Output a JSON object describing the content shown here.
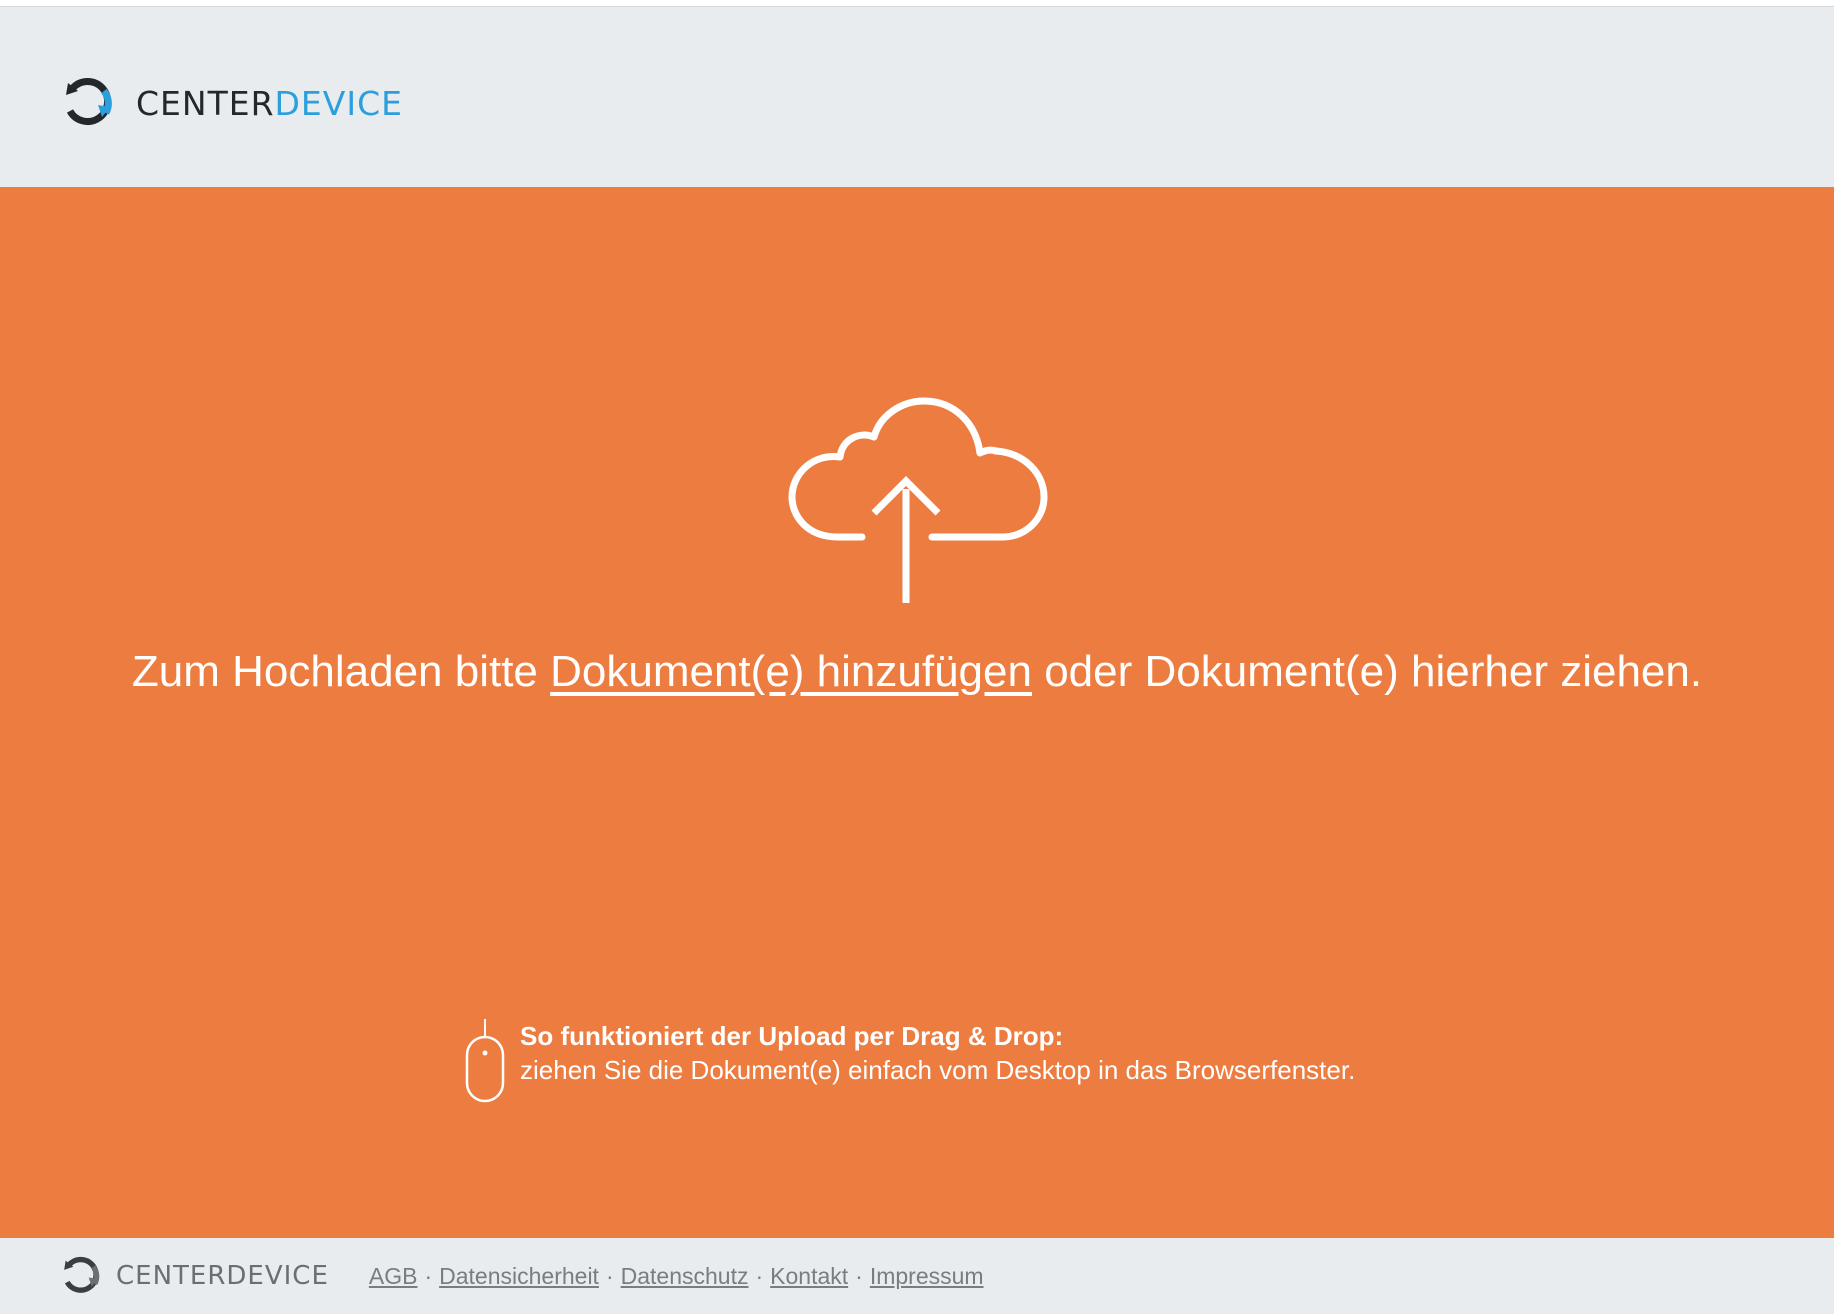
{
  "header": {
    "brand_dark": "CENTER",
    "brand_blue": "DEVICE"
  },
  "dropzone": {
    "text_before": "Zum Hochladen bitte ",
    "link_label": "Dokument(e) hinzufügen",
    "text_after": " oder Dokument(e) hierher ziehen.",
    "hint_title": "So funktioniert der Upload per Drag & Drop:",
    "hint_body": "ziehen Sie die Dokument(e) einfach vom Desktop in das Browserfenster.",
    "icons": {
      "main": "cloud-upload-icon",
      "hint": "mouse-icon"
    }
  },
  "footer": {
    "brand": "CENTERDEVICE",
    "separator": "·",
    "links": [
      {
        "label": "AGB"
      },
      {
        "label": "Datensicherheit"
      },
      {
        "label": "Datenschutz"
      },
      {
        "label": "Kontakt"
      },
      {
        "label": "Impressum"
      }
    ]
  },
  "colors": {
    "accent_orange": "#ed7c40",
    "brand_blue": "#2a9fdc",
    "background_gray": "#e9ecef"
  }
}
